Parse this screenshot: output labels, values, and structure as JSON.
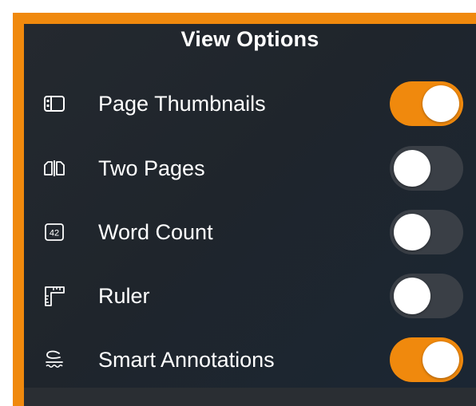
{
  "header": {
    "title": "View Options"
  },
  "colors": {
    "accent": "#f0890d",
    "toggle_off": "#3a3f46",
    "panel_bg": "#1f252c"
  },
  "options": [
    {
      "label": "Page Thumbnails",
      "icon": "page-thumbnails-icon",
      "enabled": true
    },
    {
      "label": "Two Pages",
      "icon": "two-pages-icon",
      "enabled": false
    },
    {
      "label": "Word Count",
      "icon": "word-count-icon",
      "icon_text": "42",
      "enabled": false
    },
    {
      "label": "Ruler",
      "icon": "ruler-icon",
      "enabled": false
    },
    {
      "label": "Smart Annotations",
      "icon": "smart-annotations-icon",
      "enabled": true
    }
  ]
}
